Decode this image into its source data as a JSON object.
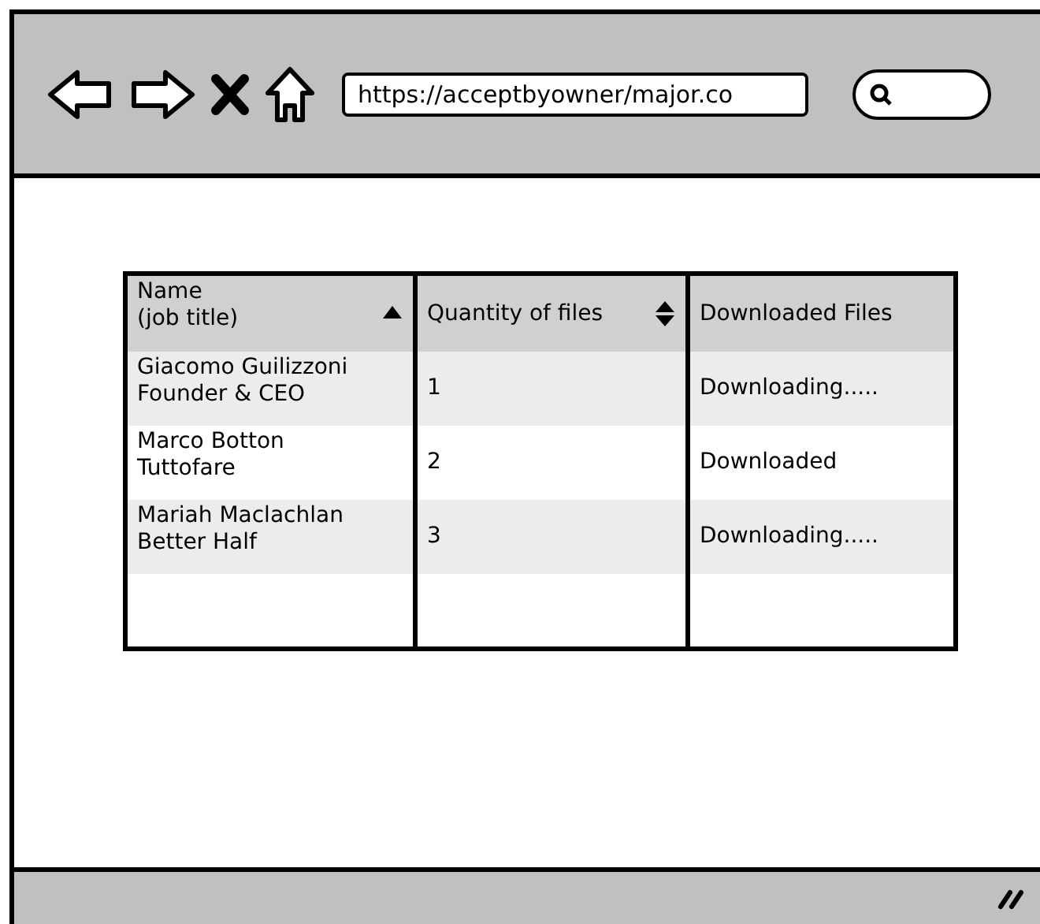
{
  "browser": {
    "url": "https://acceptbyowner/major.co"
  },
  "table": {
    "columns": [
      {
        "label": "Name\n(job title)",
        "sortable": true,
        "sorted": true
      },
      {
        "label": "Quantity of files",
        "sortable": true,
        "sorted": false
      },
      {
        "label": "Downloaded Files",
        "sortable": false,
        "sorted": false
      }
    ],
    "rows": [
      {
        "name": "Giacomo Guilizzoni\nFounder & CEO",
        "quantity": "1",
        "status": "Downloading....."
      },
      {
        "name": "Marco Botton\nTuttofare",
        "quantity": "2",
        "status": "Downloaded"
      },
      {
        "name": "Mariah Maclachlan\nBetter Half",
        "quantity": "3",
        "status": "Downloading....."
      }
    ]
  }
}
